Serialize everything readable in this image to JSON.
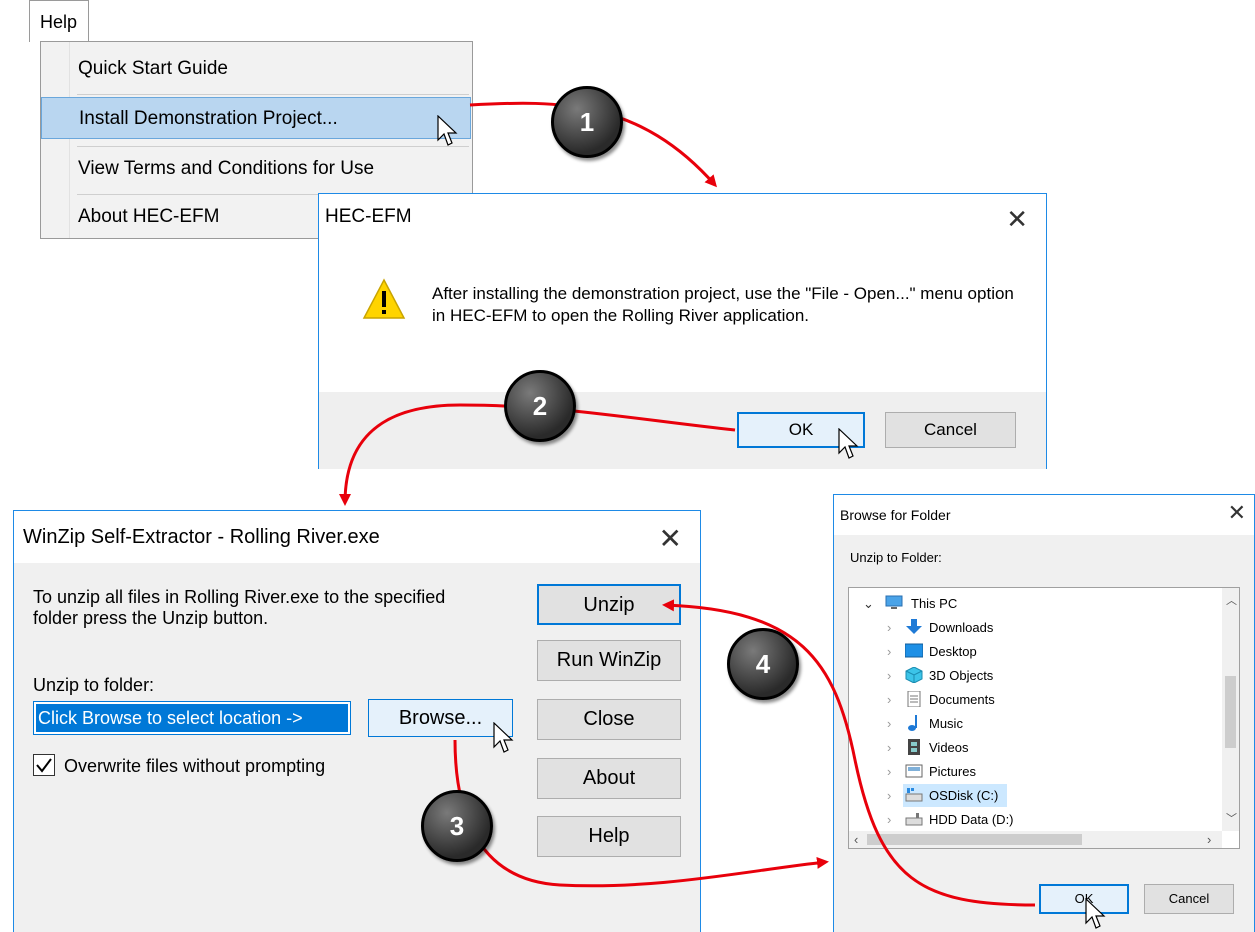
{
  "help_menu": {
    "title": "Help",
    "items": [
      {
        "label": "Quick Start Guide"
      },
      {
        "label": "Install Demonstration Project..."
      },
      {
        "label": "View Terms and Conditions for Use"
      },
      {
        "label": "About HEC-EFM"
      }
    ]
  },
  "hec_dialog": {
    "title": "HEC-EFM",
    "close_symbol": "✕",
    "message": "After installing the demonstration project, use the \"File - Open...\" menu option in HEC-EFM to open the Rolling River application.",
    "ok_label": "OK",
    "cancel_label": "Cancel",
    "icon": "warning-icon"
  },
  "winzip_dialog": {
    "title": "WinZip Self-Extractor - Rolling River.exe",
    "close_symbol": "✕",
    "description": "To unzip all files in Rolling River.exe to the specified folder press the Unzip button.",
    "folder_label": "Unzip to folder:",
    "folder_value": "Click Browse to select location ->",
    "browse_label": "Browse...",
    "overwrite_label": "Overwrite files without prompting",
    "overwrite_checked": true,
    "buttons": {
      "unzip": "Unzip",
      "run_winzip": "Run WinZip",
      "close": "Close",
      "about": "About",
      "help": "Help"
    }
  },
  "browse_dialog": {
    "title": "Browse for Folder",
    "close_symbol": "✕",
    "prompt": "Unzip to Folder:",
    "tree": [
      {
        "label": "This PC",
        "icon": "computer-icon",
        "expanded": true
      },
      {
        "label": "Downloads",
        "icon": "download-arrow-icon"
      },
      {
        "label": "Desktop",
        "icon": "desktop-icon"
      },
      {
        "label": "3D Objects",
        "icon": "cube-icon"
      },
      {
        "label": "Documents",
        "icon": "document-icon"
      },
      {
        "label": "Music",
        "icon": "music-note-icon"
      },
      {
        "label": "Videos",
        "icon": "film-icon"
      },
      {
        "label": "Pictures",
        "icon": "picture-icon"
      },
      {
        "label": "OSDisk (C:)",
        "icon": "drive-icon",
        "selected": true
      },
      {
        "label": "HDD Data (D:)",
        "icon": "drive-icon"
      }
    ],
    "ok_label": "OK",
    "cancel_label": "Cancel"
  },
  "steps": [
    "1",
    "2",
    "3",
    "4"
  ],
  "colors": {
    "arrow": "#e8000b",
    "accent": "#0078d7",
    "menu_highlight": "#b9d6f0",
    "warning_yellow": "#ffd400"
  }
}
